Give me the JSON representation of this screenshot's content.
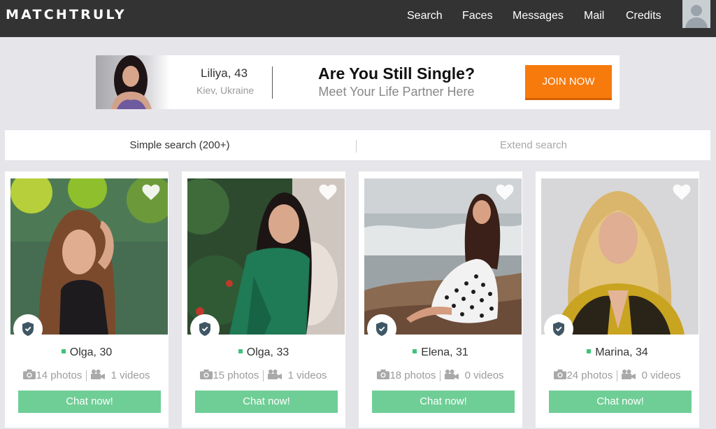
{
  "header": {
    "logo": "MATCHTRULY",
    "nav": [
      "Search",
      "Faces",
      "Messages",
      "Mail",
      "Credits"
    ]
  },
  "banner": {
    "name": "Liliya, 43",
    "location": "Kiev, Ukraine",
    "headline": "Are You Still Single?",
    "subheadline": "Meet Your Life Partner Here",
    "cta": "JOIN NOW"
  },
  "search_tabs": {
    "simple": "Simple search (200+)",
    "extend": "Extend search"
  },
  "profiles": [
    {
      "name": "Olga, 30",
      "photos": "14 photos",
      "videos": "1 videos",
      "cta": "Chat now!"
    },
    {
      "name": "Olga, 33",
      "photos": "15 photos",
      "videos": "1 videos",
      "cta": "Chat now!"
    },
    {
      "name": "Elena, 31",
      "photos": "18 photos",
      "videos": "0 videos",
      "cta": "Chat now!"
    },
    {
      "name": "Marina, 34",
      "photos": "24 photos",
      "videos": "0 videos",
      "cta": "Chat now!"
    }
  ],
  "colors": {
    "topbar": "#333333",
    "join_button": "#f77a0c",
    "chat_button": "#6fce96",
    "online": "#3fc27a",
    "background": "#e6e6ea"
  }
}
